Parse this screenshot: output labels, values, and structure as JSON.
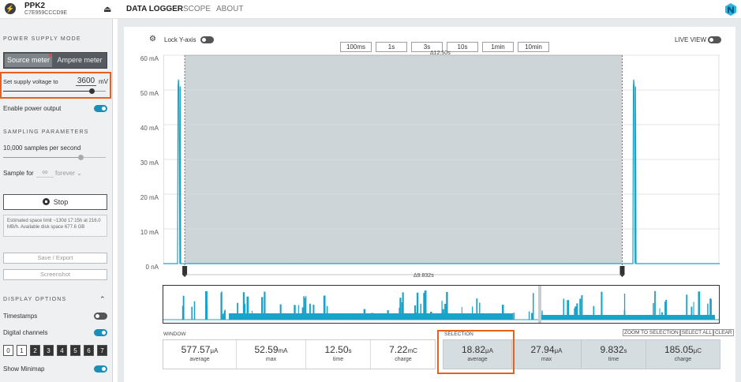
{
  "app": {
    "device_name": "PPK2",
    "device_serial": "C7E959CCCD9E"
  },
  "nav": {
    "tabs": [
      "DATA LOGGER",
      "SCOPE",
      "ABOUT"
    ]
  },
  "sidebar": {
    "power_supply_mode": "POWER SUPPLY MODE",
    "source_meter": "Source meter",
    "ampere_meter": "Ampere meter",
    "supply_label": "Set supply voltage to",
    "supply_value": "3600",
    "supply_unit": "mV",
    "supply_slider_level": 0.86,
    "enable_power": "Enable power output",
    "enable_power_on": true,
    "sampling_parameters": "SAMPLING PARAMETERS",
    "samples_per_second": "10,000 samples per second",
    "samples_slider_level": 0.75,
    "sample_for": "Sample for",
    "sample_for_value": "∞",
    "sample_for_unit": "forever",
    "stop_button": "Stop",
    "estimate_text": "Estimated space limit ~130d 17:15h at 216.0 MB/h. Available disk space 677.6 GB",
    "save_export": "Save / Export",
    "screenshot": "Screenshot",
    "display_options": "DISPLAY OPTIONS",
    "timestamps": "Timestamps",
    "timestamps_on": false,
    "digital_channels": "Digital channels",
    "digital_channels_on": true,
    "channels": [
      "0",
      "1",
      "2",
      "3",
      "4",
      "5",
      "6",
      "7"
    ],
    "show_minimap": "Show Minimap",
    "show_minimap_on": true
  },
  "chart_controls": {
    "lock_y_axis": "Lock Y-axis",
    "ranges": [
      "100ms",
      "1s",
      "3s",
      "10s",
      "1min",
      "10min"
    ],
    "live_view": "LIVE VIEW"
  },
  "chart_data": {
    "type": "line",
    "y_ticks": [
      "60 mA",
      "50 mA",
      "40 mA",
      "30 mA",
      "20 mA",
      "10 mA",
      "0 nA"
    ],
    "ylim": [
      0,
      60
    ],
    "y_unit": "mA",
    "window_span_label": "Δ12.50s",
    "selection_span_label": "Δ9.832s",
    "window_seconds": 12.5,
    "selection_start_s": 0.48,
    "selection_end_s": 10.31,
    "series": [
      {
        "x": [
          0,
          0.32,
          0.33,
          0.34,
          0.35,
          0.37,
          0.38,
          0.39,
          10.55,
          10.56,
          10.57,
          10.58,
          10.6,
          10.61,
          10.62,
          12.5
        ],
        "y": [
          0,
          0,
          51,
          53,
          51,
          0,
          51,
          0,
          0,
          51,
          53,
          51,
          0,
          51,
          0,
          0
        ]
      }
    ]
  },
  "stats": {
    "window_title": "WINDOW",
    "selection_title": "SELECTION",
    "zoom_to_selection": "ZOOM TO SELECTION",
    "select_all": "SELECT ALL",
    "clear": "CLEAR",
    "window": [
      {
        "value": "577.57",
        "unit": "μA",
        "label": "average"
      },
      {
        "value": "52.59",
        "unit": "mA",
        "label": "max"
      },
      {
        "value": "12.50",
        "unit": "s",
        "label": "time"
      },
      {
        "value": "7.22",
        "unit": "mC",
        "label": "charge"
      }
    ],
    "selection": [
      {
        "value": "18.82",
        "unit": "μA",
        "label": "average"
      },
      {
        "value": "27.94",
        "unit": "μA",
        "label": "max"
      },
      {
        "value": "9.832",
        "unit": "s",
        "label": "time"
      },
      {
        "value": "185.05",
        "unit": "μC",
        "label": "charge"
      }
    ]
  },
  "colors": {
    "accent": "#1b8fb5",
    "trace": "#1aa3c8",
    "highlight": "#e8611c",
    "selection_fill": "#c9d0d4"
  }
}
